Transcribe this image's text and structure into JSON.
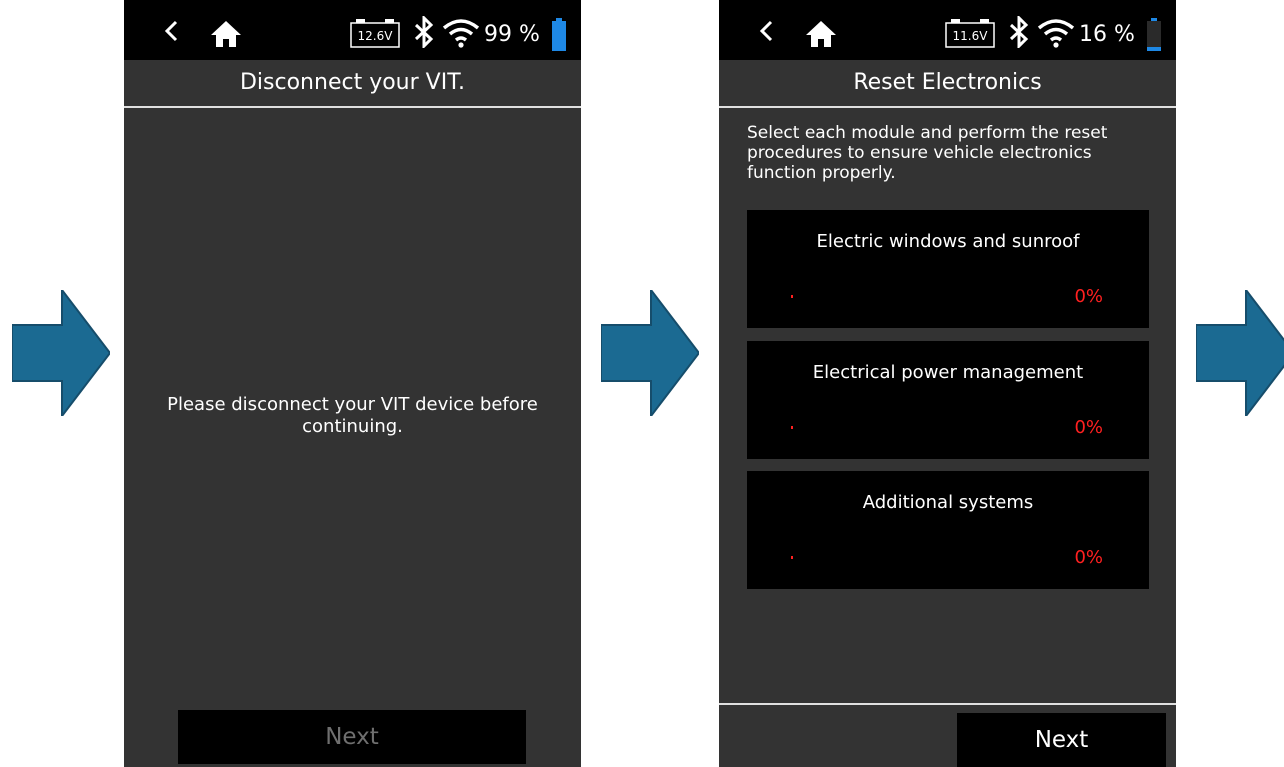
{
  "colors": {
    "arrow": "#1b6a92",
    "screen_bg": "#333333",
    "bar_bg": "#000000",
    "progress": "#ff2020",
    "battery_full": "#1e88e5",
    "disabled_text": "#6f6f6f"
  },
  "flow_arrows": [
    "arrow-right-icon",
    "arrow-right-icon",
    "arrow-right-icon"
  ],
  "screen1": {
    "status": {
      "back_icon": "chevron-left-icon",
      "home_icon": "home-icon",
      "vehicle_voltage": "12.6V",
      "bluetooth_icon": "bluetooth-icon",
      "wifi_icon": "wifi-icon",
      "battery_percent": "99 %",
      "battery_level": 0.99
    },
    "title": "Disconnect your VIT.",
    "message": "Please disconnect your VIT device before continuing.",
    "next_label": "Next"
  },
  "screen2": {
    "status": {
      "back_icon": "chevron-left-icon",
      "home_icon": "home-icon",
      "vehicle_voltage": "11.6V",
      "bluetooth_icon": "bluetooth-icon",
      "wifi_icon": "wifi-icon",
      "battery_percent": "16 %",
      "battery_level": 0.16
    },
    "title": "Reset Electronics",
    "intro": "Select each module and perform the reset procedures to ensure vehicle electronics function properly.",
    "modules": [
      {
        "name": "Electric windows and sunroof",
        "progress": "0%"
      },
      {
        "name": "Electrical power management",
        "progress": "0%"
      },
      {
        "name": "Additional systems",
        "progress": "0%"
      }
    ],
    "next_label": "Next"
  }
}
